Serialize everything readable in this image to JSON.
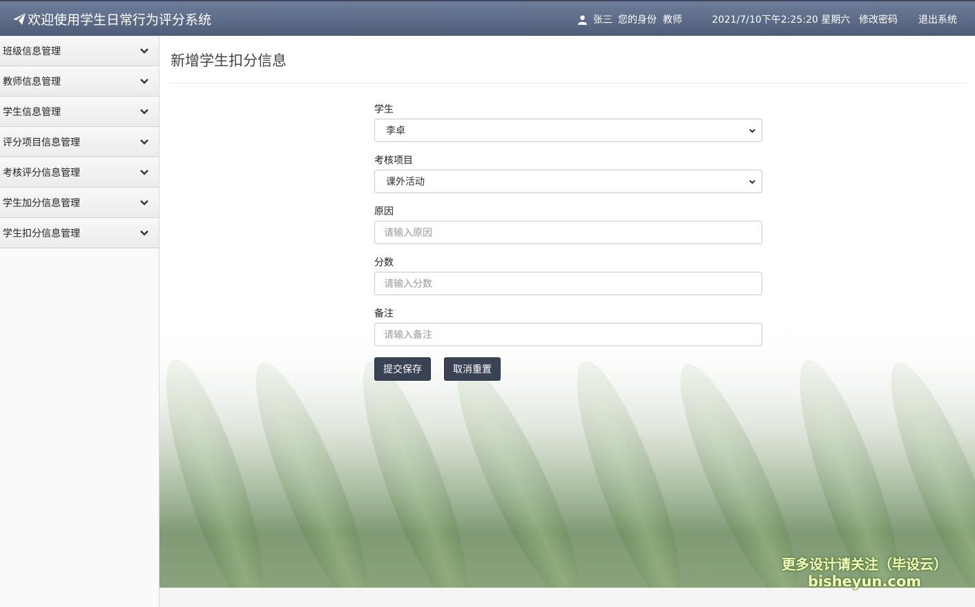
{
  "header": {
    "title": "欢迎使用学生日常行为评分系统",
    "user_name": "张三",
    "role_text": "您的身份  教师",
    "datetime": "2021/7/10下午2:25:20 星期六",
    "change_password": "修改密码",
    "logout": "退出系统"
  },
  "sidebar": {
    "items": [
      {
        "label": "班级信息管理"
      },
      {
        "label": "教师信息管理"
      },
      {
        "label": "学生信息管理"
      },
      {
        "label": "评分项目信息管理"
      },
      {
        "label": "考核评分信息管理"
      },
      {
        "label": "学生加分信息管理"
      },
      {
        "label": "学生扣分信息管理"
      }
    ]
  },
  "main": {
    "title": "新增学生扣分信息",
    "form": {
      "student_label": "学生",
      "student_value": "李卓",
      "project_label": "考核项目",
      "project_value": "课外活动",
      "reason_label": "原因",
      "reason_placeholder": "请输入原因",
      "score_label": "分数",
      "score_placeholder": "请输入分数",
      "remark_label": "备注",
      "remark_placeholder": "请输入备注",
      "submit": "提交保存",
      "reset": "取消重置"
    }
  },
  "watermark": {
    "line1": "更多设计请关注（毕设云）",
    "line2": "bisheyun.com"
  },
  "colors": {
    "header": "#5a6885",
    "button": "#3a4355"
  }
}
